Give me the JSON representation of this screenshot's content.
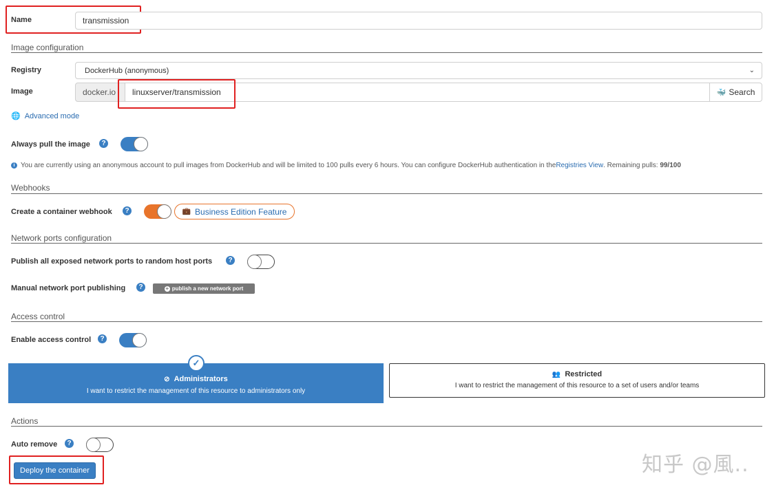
{
  "name_field": {
    "label": "Name",
    "value": "transmission"
  },
  "image_config": {
    "section_title": "Image configuration",
    "registry_label": "Registry",
    "registry_value": "DockerHub (anonymous)",
    "image_label": "Image",
    "image_prefix": "docker.io",
    "image_value": "linuxserver/transmission",
    "search_label": "Search",
    "advanced_mode": "Advanced mode"
  },
  "always_pull": {
    "label": "Always pull the image",
    "enabled": true
  },
  "info_notice": {
    "text": "You are currently using an anonymous account to pull images from DockerHub and will be limited to 100 pulls every 6 hours. You can configure DockerHub authentication in the ",
    "link": "Registries View",
    "suffix": ". Remaining pulls: ",
    "remaining": "99/100"
  },
  "webhooks": {
    "section_title": "Webhooks",
    "label": "Create a container webhook",
    "be_badge": "Business Edition Feature"
  },
  "network": {
    "section_title": "Network ports configuration",
    "publish_all_label": "Publish all exposed network ports to random host ports",
    "manual_label": "Manual network port publishing",
    "publish_button": "publish a new network port"
  },
  "access": {
    "section_title": "Access control",
    "enable_label": "Enable access control",
    "admin_title": "Administrators",
    "admin_desc": "I want to restrict the management of this resource to administrators only",
    "restricted_title": "Restricted",
    "restricted_desc": "I want to restrict the management of this resource to a set of users and/or teams"
  },
  "actions": {
    "section_title": "Actions",
    "auto_remove_label": "Auto remove",
    "deploy_button": "Deploy the container"
  },
  "watermark": "知乎 @風..",
  "colors": {
    "primary": "#3a7fc3",
    "orange": "#e8742b",
    "highlight": "#e02020"
  }
}
